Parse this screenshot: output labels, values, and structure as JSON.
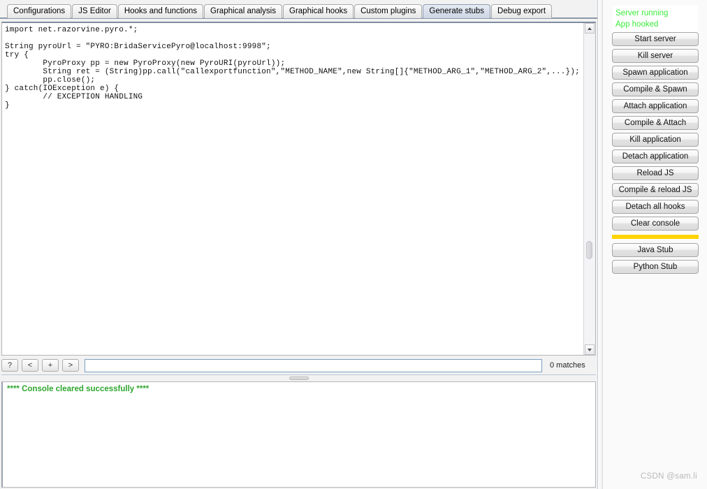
{
  "tabs": [
    {
      "label": "Configurations",
      "selected": false
    },
    {
      "label": "JS Editor",
      "selected": false
    },
    {
      "label": "Hooks and functions",
      "selected": false
    },
    {
      "label": "Graphical analysis",
      "selected": false
    },
    {
      "label": "Graphical hooks",
      "selected": false
    },
    {
      "label": "Custom plugins",
      "selected": false
    },
    {
      "label": "Generate stubs",
      "selected": true
    },
    {
      "label": "Debug export",
      "selected": false
    }
  ],
  "editor": {
    "code": "import net.razorvine.pyro.*;\n\nString pyroUrl = \"PYRO:BridaServicePyro@localhost:9998\";\ntry {\n        PyroProxy pp = new PyroProxy(new PyroURI(pyroUrl));\n        String ret = (String)pp.call(\"callexportfunction\",\"METHOD_NAME\",new String[]{\"METHOD_ARG_1\",\"METHOD_ARG_2\",...});\n        pp.close();\n} catch(IOException e) {\n        // EXCEPTION HANDLING\n}",
    "scrollbar": {
      "up_arrow": "▲",
      "down_arrow": "▼"
    }
  },
  "findbar": {
    "help_button": "?",
    "prev_button": "<",
    "add_button": "+",
    "next_button": ">",
    "input_value": "",
    "input_placeholder": "",
    "matches_label": "0 matches"
  },
  "console": {
    "line": "**** Console cleared successfully ****",
    "text_color": "#2fa62f"
  },
  "sidebar": {
    "status": [
      {
        "label": "Server running",
        "color": "#3bec3b"
      },
      {
        "label": "App hooked",
        "color": "#3bec3b"
      }
    ],
    "buttons": [
      {
        "label": "Start server"
      },
      {
        "label": "Kill server"
      },
      {
        "label": "Spawn application"
      },
      {
        "label": "Compile & Spawn"
      },
      {
        "label": "Attach application"
      },
      {
        "label": "Compile & Attach"
      },
      {
        "label": "Kill application"
      },
      {
        "label": "Detach application"
      },
      {
        "label": "Reload JS"
      },
      {
        "label": "Compile & reload JS"
      },
      {
        "label": "Detach all hooks"
      },
      {
        "label": "Clear console"
      }
    ],
    "separator_color": "#ffd400",
    "stub_buttons": [
      {
        "label": "Java Stub"
      },
      {
        "label": "Python Stub"
      }
    ]
  },
  "watermark": {
    "text": "CSDN @sam.li"
  }
}
